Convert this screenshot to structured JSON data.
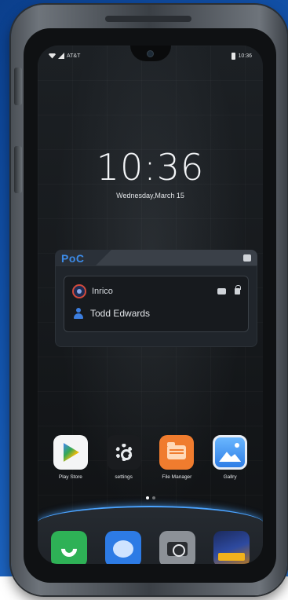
{
  "status_bar": {
    "carrier": "AT&T",
    "time": "10:36"
  },
  "lock_clock": {
    "time": "10:36",
    "date": "Wednesday,March 15"
  },
  "poc_widget": {
    "title": "PoC",
    "group_name": "Inrico",
    "user_name": "Todd Edwards"
  },
  "apps": [
    {
      "label": "Play Store",
      "icon": "play-store-icon"
    },
    {
      "label": "settings",
      "icon": "gear-icon"
    },
    {
      "label": "File Manager",
      "icon": "folder-icon"
    },
    {
      "label": "Gallry",
      "icon": "gallery-icon"
    }
  ],
  "dock": [
    {
      "icon": "phone-icon"
    },
    {
      "icon": "messages-icon"
    },
    {
      "icon": "camera-icon"
    },
    {
      "icon": "game-icon"
    }
  ],
  "colors": {
    "accent": "#3c8be8",
    "dock_glow": "#4aa3ff",
    "background": "#1456b0"
  }
}
